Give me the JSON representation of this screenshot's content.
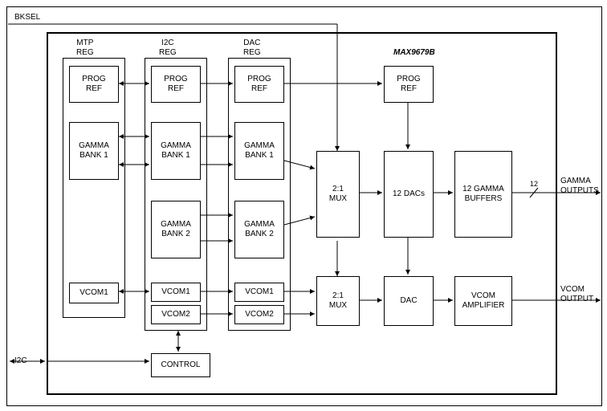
{
  "pins": {
    "bksel": "BKSEL",
    "i2c": "I2C"
  },
  "part": "MAX9679B",
  "columns": {
    "mtp": {
      "title_l1": "MTP",
      "title_l2": "REG"
    },
    "i2c": {
      "title_l1": "I2C",
      "title_l2": "REG"
    },
    "dac": {
      "title_l1": "DAC",
      "title_l2": "REG"
    }
  },
  "blocks": {
    "mtp_prog": "PROG\nREF",
    "mtp_gamma1": "GAMMA\nBANK 1",
    "mtp_vcom1": "VCOM1",
    "i2c_prog": "PROG\nREF",
    "i2c_gamma1": "GAMMA\nBANK 1",
    "i2c_gamma2": "GAMMA\nBANK 2",
    "i2c_vcom1": "VCOM1",
    "i2c_vcom2": "VCOM2",
    "dac_prog": "PROG\nREF",
    "dac_gamma1": "GAMMA\nBANK 1",
    "dac_gamma2": "GAMMA\nBANK 2",
    "dac_vcom1": "VCOM1",
    "dac_vcom2": "VCOM2",
    "prog_ref_r": "PROG\nREF",
    "mux1": "2:1\nMUX",
    "mux2": "2:1\nMUX",
    "dacs12": "12 DACs",
    "dac_single": "DAC",
    "gbuffers": "12 GAMMA\nBUFFERS",
    "vcom_amp": "VCOM\nAMPLIFIER",
    "control": "CONTROL"
  },
  "outputs": {
    "gamma": "GAMMA\nOUTPUTS",
    "gamma_n": "12",
    "vcom": "VCOM\nOUTPUT"
  }
}
